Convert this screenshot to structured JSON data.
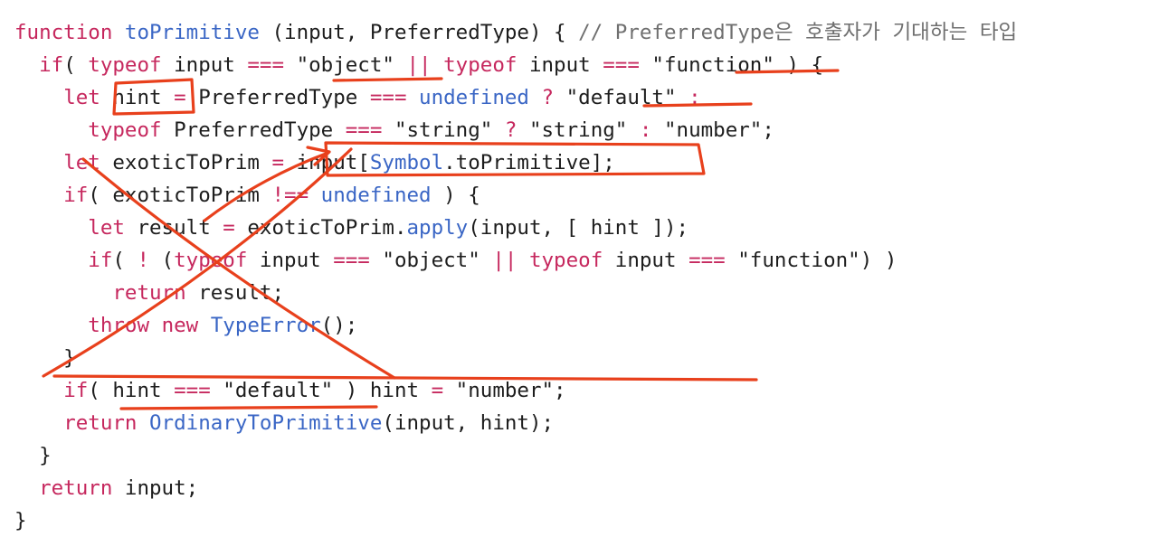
{
  "lines": [
    [
      {
        "t": "function ",
        "c": "kw"
      },
      {
        "t": "toPrimitive",
        "c": "fn"
      },
      {
        "t": " (input, PreferredType) { ",
        "c": ""
      },
      {
        "t": "// PreferredType은 호출자가 기대하는 타입",
        "c": "cm"
      }
    ],
    [
      {
        "t": "  ",
        "c": ""
      },
      {
        "t": "if",
        "c": "kw"
      },
      {
        "t": "( ",
        "c": ""
      },
      {
        "t": "typeof",
        "c": "kw"
      },
      {
        "t": " input ",
        "c": ""
      },
      {
        "t": "===",
        "c": "op"
      },
      {
        "t": " \"object\" ",
        "c": "str"
      },
      {
        "t": "||",
        "c": "op"
      },
      {
        "t": " ",
        "c": ""
      },
      {
        "t": "typeof",
        "c": "kw"
      },
      {
        "t": " input ",
        "c": ""
      },
      {
        "t": "===",
        "c": "op"
      },
      {
        "t": " \"function\"",
        "c": "str"
      },
      {
        "t": " ) {",
        "c": ""
      }
    ],
    [
      {
        "t": "    ",
        "c": ""
      },
      {
        "t": "let",
        "c": "kw"
      },
      {
        "t": " hint ",
        "c": ""
      },
      {
        "t": "=",
        "c": "op"
      },
      {
        "t": " PreferredType ",
        "c": ""
      },
      {
        "t": "===",
        "c": "op"
      },
      {
        "t": " ",
        "c": ""
      },
      {
        "t": "undefined",
        "c": "fn"
      },
      {
        "t": " ",
        "c": ""
      },
      {
        "t": "?",
        "c": "op"
      },
      {
        "t": " \"default\" ",
        "c": "str"
      },
      {
        "t": ":",
        "c": "op"
      }
    ],
    [
      {
        "t": "      ",
        "c": ""
      },
      {
        "t": "typeof",
        "c": "kw"
      },
      {
        "t": " PreferredType ",
        "c": ""
      },
      {
        "t": "===",
        "c": "op"
      },
      {
        "t": " \"string\" ",
        "c": "str"
      },
      {
        "t": "?",
        "c": "op"
      },
      {
        "t": " \"string\" ",
        "c": "str"
      },
      {
        "t": ":",
        "c": "op"
      },
      {
        "t": " \"number\";",
        "c": "str"
      }
    ],
    [
      {
        "t": "    ",
        "c": ""
      },
      {
        "t": "let",
        "c": "kw"
      },
      {
        "t": " exoticToPrim ",
        "c": ""
      },
      {
        "t": "=",
        "c": "op"
      },
      {
        "t": " input[",
        "c": ""
      },
      {
        "t": "Symbol",
        "c": "fn"
      },
      {
        "t": ".toPrimitive];",
        "c": ""
      }
    ],
    [
      {
        "t": "    ",
        "c": ""
      },
      {
        "t": "if",
        "c": "kw"
      },
      {
        "t": "( exoticToPrim ",
        "c": ""
      },
      {
        "t": "!==",
        "c": "op"
      },
      {
        "t": " ",
        "c": ""
      },
      {
        "t": "undefined",
        "c": "fn"
      },
      {
        "t": " ) {",
        "c": ""
      }
    ],
    [
      {
        "t": "      ",
        "c": ""
      },
      {
        "t": "let",
        "c": "kw"
      },
      {
        "t": " result ",
        "c": ""
      },
      {
        "t": "=",
        "c": "op"
      },
      {
        "t": " exoticToPrim.",
        "c": ""
      },
      {
        "t": "apply",
        "c": "fn"
      },
      {
        "t": "(input, [ hint ]);",
        "c": ""
      }
    ],
    [
      {
        "t": "      ",
        "c": ""
      },
      {
        "t": "if",
        "c": "kw"
      },
      {
        "t": "( ",
        "c": ""
      },
      {
        "t": "!",
        "c": "op"
      },
      {
        "t": " (",
        "c": ""
      },
      {
        "t": "typeof",
        "c": "kw"
      },
      {
        "t": " input ",
        "c": ""
      },
      {
        "t": "===",
        "c": "op"
      },
      {
        "t": " \"object\" ",
        "c": "str"
      },
      {
        "t": "||",
        "c": "op"
      },
      {
        "t": " ",
        "c": ""
      },
      {
        "t": "typeof",
        "c": "kw"
      },
      {
        "t": " input ",
        "c": ""
      },
      {
        "t": "===",
        "c": "op"
      },
      {
        "t": " \"function\"",
        "c": "str"
      },
      {
        "t": ") )",
        "c": ""
      }
    ],
    [
      {
        "t": "        ",
        "c": ""
      },
      {
        "t": "return",
        "c": "kw"
      },
      {
        "t": " result;",
        "c": ""
      }
    ],
    [
      {
        "t": "      ",
        "c": ""
      },
      {
        "t": "throw",
        "c": "kw"
      },
      {
        "t": " ",
        "c": ""
      },
      {
        "t": "new",
        "c": "kw"
      },
      {
        "t": " ",
        "c": ""
      },
      {
        "t": "TypeError",
        "c": "fn"
      },
      {
        "t": "();",
        "c": ""
      }
    ],
    [
      {
        "t": "    }",
        "c": ""
      }
    ],
    [
      {
        "t": "    ",
        "c": ""
      },
      {
        "t": "if",
        "c": "kw"
      },
      {
        "t": "( hint ",
        "c": ""
      },
      {
        "t": "===",
        "c": "op"
      },
      {
        "t": " \"default\"",
        "c": "str"
      },
      {
        "t": " ) hint ",
        "c": ""
      },
      {
        "t": "=",
        "c": "op"
      },
      {
        "t": " \"number\";",
        "c": "str"
      }
    ],
    [
      {
        "t": "    ",
        "c": ""
      },
      {
        "t": "return",
        "c": "kw"
      },
      {
        "t": " ",
        "c": ""
      },
      {
        "t": "OrdinaryToPrimitive",
        "c": "fn"
      },
      {
        "t": "(input, hint);",
        "c": ""
      }
    ],
    [
      {
        "t": "  }",
        "c": ""
      }
    ],
    [
      {
        "t": "  ",
        "c": ""
      },
      {
        "t": "return",
        "c": "kw"
      },
      {
        "t": " input;",
        "c": ""
      }
    ],
    [
      {
        "t": "}",
        "c": ""
      }
    ]
  ],
  "colors": {
    "keyword": "#c6285e",
    "builtin": "#3a66c5",
    "comment": "#6f6f6f",
    "text": "#1d1d1d",
    "ink": "#e8401c"
  }
}
